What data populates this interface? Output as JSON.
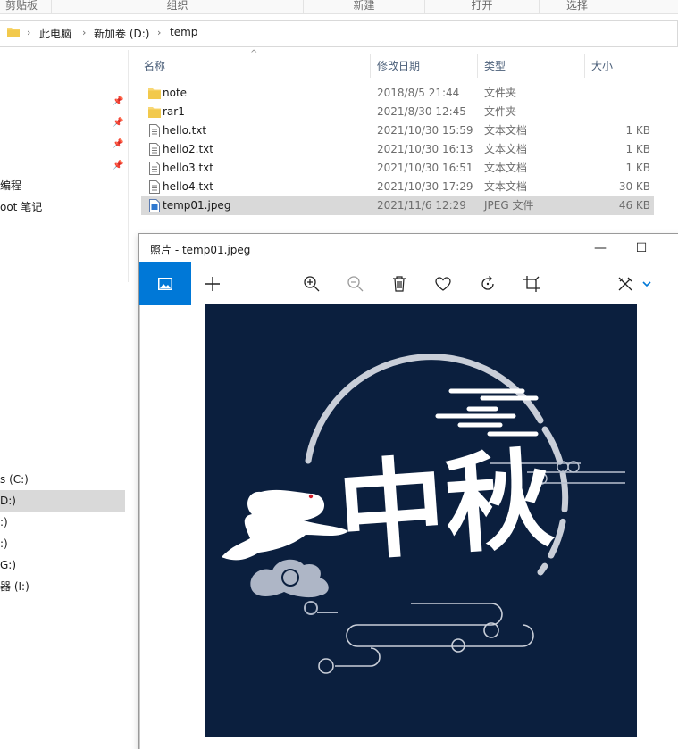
{
  "ribbon": {
    "groups": [
      "剪贴板",
      "组织",
      "新建",
      "打开",
      "选择"
    ]
  },
  "address": {
    "crumbs": [
      "此电脑",
      "新加卷 (D:)",
      "temp"
    ]
  },
  "nav": {
    "items": [
      "编程",
      "oot 笔记",
      "s (C:)",
      "D:)",
      ":)",
      ":)",
      "G:)",
      "器 (I:)"
    ]
  },
  "columns": {
    "name": "名称",
    "date": "修改日期",
    "type": "类型",
    "size": "大小"
  },
  "files": [
    {
      "name": "note",
      "date": "2018/8/5 21:44",
      "type": "文件夹",
      "size": "",
      "icon": "folder-icon"
    },
    {
      "name": "rar1",
      "date": "2021/8/30 12:45",
      "type": "文件夹",
      "size": "",
      "icon": "folder-icon"
    },
    {
      "name": "hello.txt",
      "date": "2021/10/30 15:59",
      "type": "文本文档",
      "size": "1 KB",
      "icon": "text-file-icon"
    },
    {
      "name": "hello2.txt",
      "date": "2021/10/30 16:13",
      "type": "文本文档",
      "size": "1 KB",
      "icon": "text-file-icon"
    },
    {
      "name": "hello3.txt",
      "date": "2021/10/30 16:51",
      "type": "文本文档",
      "size": "1 KB",
      "icon": "text-file-icon"
    },
    {
      "name": "hello4.txt",
      "date": "2021/10/30 17:29",
      "type": "文本文档",
      "size": "30 KB",
      "icon": "text-file-icon"
    },
    {
      "name": "temp01.jpeg",
      "date": "2021/11/6 12:29",
      "type": "JPEG 文件",
      "size": "46 KB",
      "icon": "image-file-icon",
      "selected": true
    }
  ],
  "photos": {
    "title": "照片 - temp01.jpeg",
    "image_text": "中秋",
    "colors": {
      "accent": "#0078d7",
      "image_bg": "#0b1f3e"
    }
  }
}
